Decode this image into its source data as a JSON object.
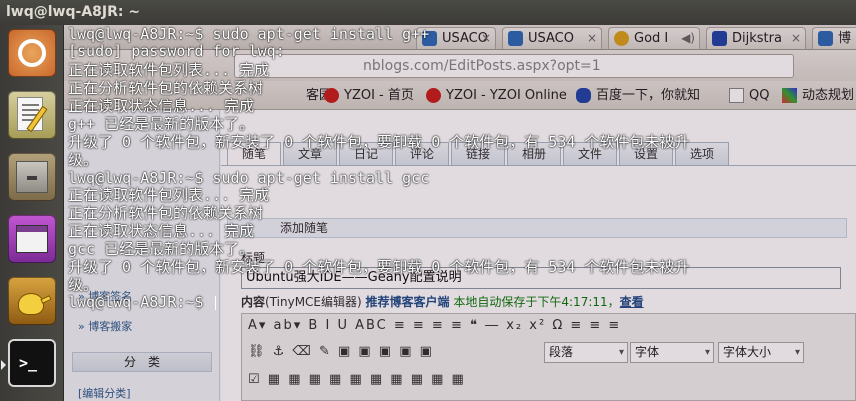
{
  "window": {
    "title": "lwq@lwq-A8JR: ~"
  },
  "launcher": {
    "items": [
      "ubuntu-dash-icon",
      "text-editor-icon",
      "file-cabinet-icon",
      "window-app-icon",
      "teapot-icon",
      "terminal-icon"
    ]
  },
  "browser": {
    "tabs": [
      {
        "label": "USACO"
      },
      {
        "label": "USACO"
      },
      {
        "label": "God I"
      },
      {
        "label": "Dijkstra"
      },
      {
        "label": "博"
      }
    ],
    "url": "nblogs.com/EditPosts.aspx?opt=1",
    "bookmarks": [
      {
        "label": "客园"
      },
      {
        "label": "YZOI - 首页"
      },
      {
        "label": "YZOI - YZOI Online"
      },
      {
        "label": "百度一下，你就知"
      },
      {
        "label": "QQ"
      },
      {
        "label": "动态规划"
      }
    ],
    "nav_tabs": [
      "随笔",
      "文章",
      "日记",
      "评论",
      "链接",
      "相册",
      "文件",
      "设置",
      "选项"
    ],
    "sidebar": {
      "links": [
        "» 博客签名",
        "» 博客搬家"
      ],
      "box_title": "分　类",
      "edit_category": "[编辑分类]"
    },
    "section_title": "添加随笔",
    "title_label": "标题",
    "title_value": "Ubuntu强大IDE——Geany配置说明",
    "content_label": "内容",
    "content_hint": "(TinyMCE编辑器)",
    "client_link": "推荐博客客户端",
    "autosave": "本地自动保存于下午4:17:11，",
    "view_link": "查看",
    "editor": {
      "row1": "A▾ ab▾ B I U ABC ≡ ≡ ≡ ≡ ❝ ― x₂ x² Ω ≡ ≡ ≡",
      "format_select": "段落",
      "font_select": "字体",
      "size_select": "字体大小"
    }
  },
  "terminal": {
    "lines": [
      "lwq@lwq-A8JR:~$ sudo apt-get install g++",
      "[sudo] password for lwq:",
      "正在读取软件包列表... 完成",
      "正在分析软件包的依赖关系树",
      "正在读取状态信息... 完成",
      "g++ 已经是最新的版本了。",
      "升级了 0 个软件包，新安装了 0 个软件包，要卸载 0 个软件包，有 534 个软件包未被升",
      "级。",
      "lwq@lwq-A8JR:~$ sudo apt-get install gcc",
      "正在读取软件包列表... 完成",
      "正在分析软件包的依赖关系树",
      "正在读取状态信息... 完成",
      "gcc 已经是最新的版本了。",
      "升级了 0 个软件包，新安装了 0 个软件包，要卸载 0 个软件包，有 534 个软件包未被升",
      "级。",
      "lwq@lwq-A8JR:~$ "
    ]
  }
}
